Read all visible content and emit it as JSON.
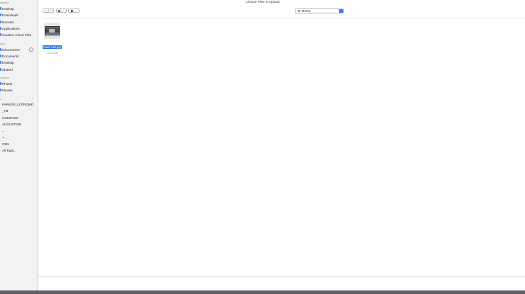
{
  "dialog": {
    "title": "Choose Files to Upload"
  },
  "sidebar": {
    "sections": [
      {
        "label": "avorites"
      },
      {
        "label": "loud"
      },
      {
        "label": "ocations"
      },
      {
        "label": "s"
      }
    ],
    "favorites": [
      {
        "label": "Desktop",
        "icon": "desktop-icon"
      },
      {
        "label": "Downloads",
        "icon": "downloads-icon"
      },
      {
        "label": "Recents",
        "icon": "recents-icon"
      },
      {
        "label": "Applications",
        "icon": "applications-icon"
      },
      {
        "label": "Creative Cloud Files",
        "icon": "creative-cloud-icon"
      }
    ],
    "cloud": [
      {
        "label": "iCloud Drive",
        "icon": "icloud-icon"
      },
      {
        "label": "Documents",
        "icon": "documents-icon"
      },
      {
        "label": "Desktop",
        "icon": "desktop-icon"
      },
      {
        "label": "Shared",
        "icon": "shared-folder-icon"
      }
    ],
    "media": [
      {
        "label": "Photos",
        "icon": "photos-icon"
      },
      {
        "label": "Movies",
        "icon": "movies-icon"
      }
    ],
    "tags": [
      {
        "label": "PARKER_LCPROMO"
      },
      {
        "label": "_FB"
      },
      {
        "label": "COMPASS"
      },
      {
        "label": "AUGUSTINE"
      },
      {
        "label": "--"
      },
      {
        "label": "?"
      },
      {
        "label": "CMS"
      },
      {
        "label": "All Tags..."
      }
    ]
  },
  "toolbar": {
    "back_glyph": "‹",
    "forward_glyph": "›",
    "view_chevron": "⌄",
    "location": "Demo",
    "location_stepper": "⌃"
  },
  "files": [
    {
      "name": "toast-cart.jpg",
      "dimensions": "1,920×1,080"
    }
  ]
}
